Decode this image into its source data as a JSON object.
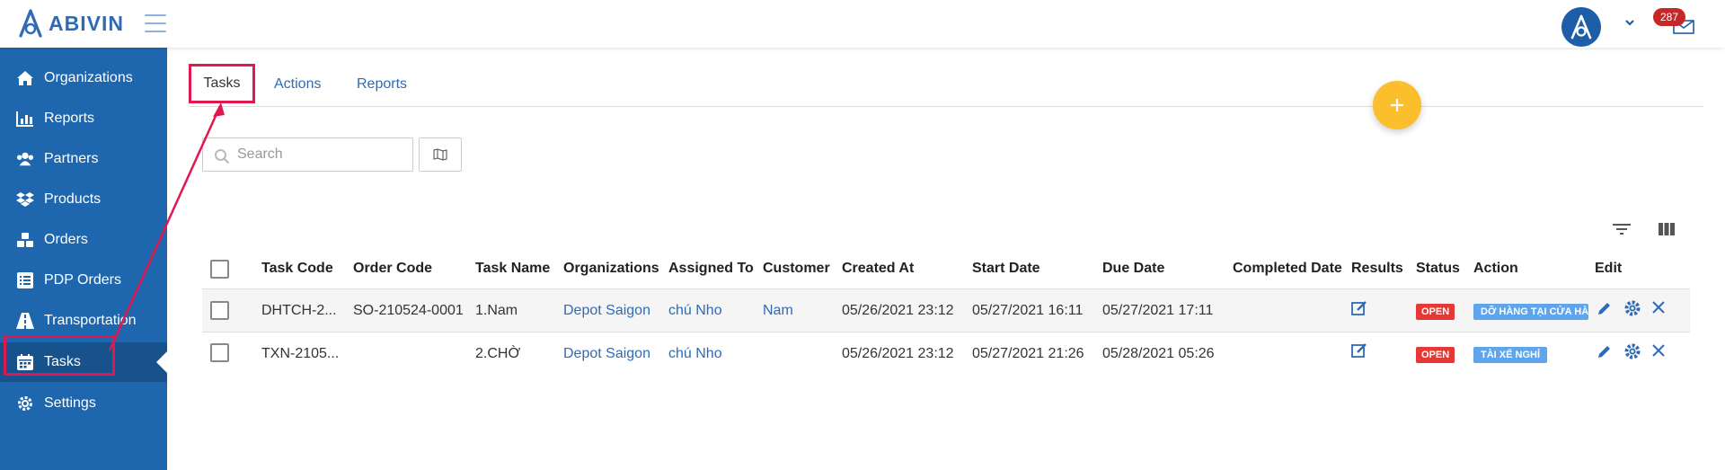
{
  "brand": {
    "name": "ABIVIN",
    "accent": "#1e66ad"
  },
  "notifications": {
    "count": "287"
  },
  "sidebar": {
    "items": [
      {
        "label": "Organizations",
        "icon": "home-icon"
      },
      {
        "label": "Reports",
        "icon": "bar-chart-icon"
      },
      {
        "label": "Partners",
        "icon": "users-icon"
      },
      {
        "label": "Products",
        "icon": "dropbox-icon"
      },
      {
        "label": "Orders",
        "icon": "cubes-icon"
      },
      {
        "label": "PDP Orders",
        "icon": "list-icon"
      },
      {
        "label": "Transportation",
        "icon": "road-icon"
      },
      {
        "label": "Tasks",
        "icon": "calendar-icon",
        "active": true
      },
      {
        "label": "Settings",
        "icon": "gear-icon"
      }
    ]
  },
  "tabs": [
    "Tasks",
    "Actions",
    "Reports"
  ],
  "search": {
    "placeholder": "Search"
  },
  "table": {
    "headers": [
      "Task Code",
      "Order Code",
      "Task Name",
      "Organizations",
      "Assigned To",
      "Customer",
      "Created At",
      "Start Date",
      "Due Date",
      "Completed Date",
      "Results",
      "Status",
      "Action",
      "Edit"
    ],
    "rows": [
      {
        "task_code": "DHTCH-2...",
        "order_code": "SO-210524-0001",
        "task_name": "1.Nam",
        "organization": "Depot Saigon",
        "assigned_to": "chú Nho",
        "customer": "Nam",
        "created_at": "05/26/2021 23:12",
        "start_date": "05/27/2021 16:11",
        "due_date": "05/27/2021 17:11",
        "completed_date": "",
        "status": "OPEN",
        "action": "DỠ HÀNG TẠI CỬA HÀ"
      },
      {
        "task_code": "TXN-2105...",
        "order_code": "",
        "task_name": "2.CHỜ",
        "organization": "Depot Saigon",
        "assigned_to": "chú Nho",
        "customer": "",
        "created_at": "05/26/2021 23:12",
        "start_date": "05/27/2021 21:26",
        "due_date": "05/28/2021 05:26",
        "completed_date": "",
        "status": "OPEN",
        "action": "TÀI XẾ NGHỈ"
      }
    ]
  },
  "colors": {
    "sidebar": "#1e66ad",
    "annotation": "#e0184f",
    "fab": "#fbbf2e",
    "status_open": "#e53935",
    "action_badge": "#5fa5ec"
  }
}
